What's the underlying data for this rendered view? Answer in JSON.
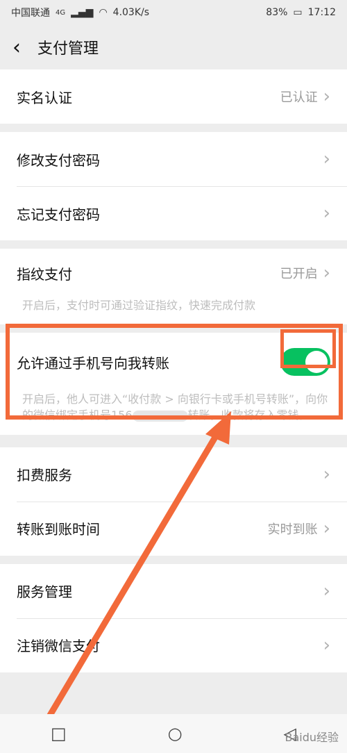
{
  "status": {
    "carrier": "中国联通",
    "network": "4G",
    "speed": "4.03K/s",
    "battery": "83%",
    "time": "17:12"
  },
  "header": {
    "title": "支付管理"
  },
  "groups": [
    {
      "rows": [
        {
          "label": "实名认证",
          "value": "已认证"
        }
      ]
    },
    {
      "rows": [
        {
          "label": "修改支付密码"
        },
        {
          "label": "忘记支付密码"
        }
      ]
    },
    {
      "rows": [
        {
          "label": "指纹支付",
          "value": "已开启",
          "desc": "开启后，支付时可通过验证指纹，快速完成付款"
        }
      ]
    },
    {
      "rows": [
        {
          "label": "允许通过手机号向我转账",
          "desc_prefix": "开启后，他人可进入“收付款 > 向银行卡或手机号转账”，向你的微信绑定手机号156",
          "desc_suffix": "转账，收款将存入零钱。"
        }
      ]
    },
    {
      "rows": [
        {
          "label": "扣费服务"
        },
        {
          "label": "转账到账时间",
          "value": "实时到账"
        }
      ]
    },
    {
      "rows": [
        {
          "label": "服务管理"
        },
        {
          "label": "注销微信支付"
        }
      ]
    }
  ],
  "watermark": "Baidu经验",
  "colors": {
    "accent": "#07c160",
    "highlight": "#f26a3a"
  }
}
